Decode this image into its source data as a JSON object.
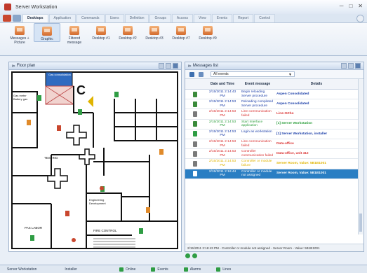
{
  "window": {
    "title": "Server Workstation"
  },
  "ribbon": {
    "tabs": [
      {
        "label": "Desktops",
        "active": true
      },
      {
        "label": "Application"
      },
      {
        "label": "Commands"
      },
      {
        "label": "Users"
      },
      {
        "label": "Definition"
      },
      {
        "label": "Groups"
      },
      {
        "label": "Access"
      },
      {
        "label": "View"
      },
      {
        "label": "Events"
      },
      {
        "label": "Report"
      },
      {
        "label": "Control"
      }
    ],
    "items": [
      {
        "label": "Messages + Picture"
      },
      {
        "label": "Graphic",
        "selected": true
      },
      {
        "label": "Filtered message"
      },
      {
        "label": "Desktop #1"
      },
      {
        "label": "Desktop #2"
      },
      {
        "label": "Desktop #3"
      },
      {
        "label": "Desktop #7"
      },
      {
        "label": "Desktop #9"
      }
    ]
  },
  "floor_plan": {
    "title": "Floor plan",
    "labels": {
      "corner": "C",
      "area_a": "Gas meter Battery gas",
      "area_b": "TESTING",
      "area_c": "Engineering Development",
      "area_d": "PAS LABOR",
      "area_e": "FIRE CONTROL",
      "highlight": "Gas consolidation"
    }
  },
  "messages": {
    "title": "Messages list",
    "filter": "All events",
    "columns": [
      "",
      "Date and Time",
      "Event message",
      "Details"
    ],
    "rows": [
      {
        "date": "2/15/2011 2:14:43 PM",
        "event": "Begin reloading Server procedure",
        "details": "Aspen Consolidated",
        "color": "#1b3ea8",
        "icon": "#3a8a3a"
      },
      {
        "date": "2/15/2011 2:14:53 PM",
        "event": "Reloading completed Server procedure",
        "details": "Aspen Consolidated",
        "color": "#1b3ea8",
        "icon": "#3a8a3a"
      },
      {
        "date": "2/15/2011 2:14:53 PM",
        "event": "Line communication failed",
        "details": "Line-Ortho",
        "color": "#d93030",
        "icon": "#7a7a7a"
      },
      {
        "date": "2/15/2011 2:14:53 PM",
        "event": "Start Interface application",
        "details": "[1] Server Workstation",
        "color": "#2a9d3a",
        "icon": "#3a8a3a"
      },
      {
        "date": "2/15/2011 2:14:53 PM",
        "event": "Login as workstation",
        "details": "[1] Server Workstation, installer",
        "color": "#1b3ea8",
        "icon": "#2f9d44"
      },
      {
        "date": "2/15/2011 2:14:53 PM",
        "event": "Line communication failed",
        "details": "Data-office",
        "color": "#d93030",
        "icon": "#7a7a7a"
      },
      {
        "date": "2/15/2011 2:14:53 PM",
        "event": "Controller communication failed",
        "details": "Data-office, unit 412",
        "color": "#d93030",
        "icon": "#7a7a7a"
      },
      {
        "date": "2/15/2011 2:14:53 PM",
        "event": "Controller or module failure",
        "details": "Server Room, Value: 5B1B1001",
        "color": "#e0b400",
        "icon": "#7a7a7a"
      },
      {
        "date": "2/15/2011 2:16:44 PM",
        "event": "Controller or module not assigned",
        "details": "Server Room, Value: 5B1B1001",
        "color": "#ffffff",
        "icon": "#ffffff",
        "selected": true
      }
    ],
    "status": "2/15/2011 2:16:43 PM - Controller or module not assigned - Server Room - Value: 5B1B1001"
  },
  "statusbar": {
    "left": "Server Workstation",
    "mid": "Installer",
    "indicators": [
      "Online",
      "Events",
      "Alarms",
      "Lines"
    ]
  }
}
